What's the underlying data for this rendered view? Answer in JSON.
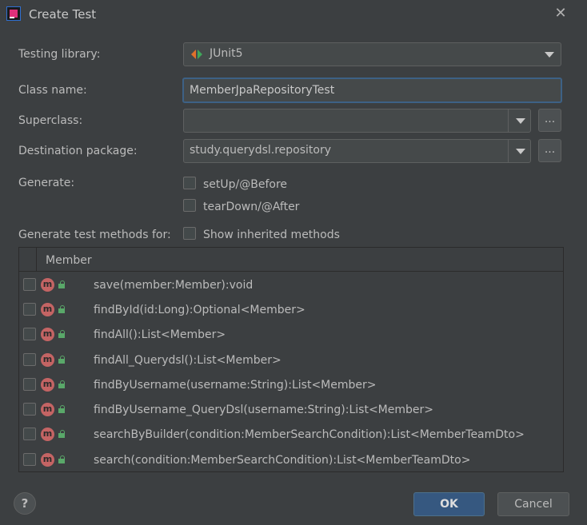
{
  "window": {
    "title": "Create Test",
    "close_icon": "close-icon"
  },
  "form": {
    "testing_library_label": "Testing library:",
    "testing_library_value": "JUnit5",
    "class_name_label": "Class name:",
    "class_name_value": "MemberJpaRepositoryTest",
    "superclass_label": "Superclass:",
    "superclass_value": "",
    "destination_label": "Destination package:",
    "destination_value": "study.querydsl.repository",
    "browse_label": "...",
    "generate_label": "Generate:",
    "setup_label": "setUp/@Before",
    "teardown_label": "tearDown/@After",
    "methods_for_label": "Generate test methods for:",
    "show_inherited_label": "Show inherited methods"
  },
  "table": {
    "header": "Member",
    "rows": [
      {
        "method": "save(member:Member):void"
      },
      {
        "method": "findById(id:Long):Optional<Member>"
      },
      {
        "method": "findAll():List<Member>"
      },
      {
        "method": "findAll_Querydsl():List<Member>"
      },
      {
        "method": "findByUsername(username:String):List<Member>"
      },
      {
        "method": "findByUsername_QueryDsl(username:String):List<Member>"
      },
      {
        "method": "searchByBuilder(condition:MemberSearchCondition):List<MemberTeamDto>"
      },
      {
        "method": "search(condition:MemberSearchCondition):List<MemberTeamDto>"
      }
    ],
    "method_icon_letter": "m"
  },
  "footer": {
    "help_label": "?",
    "ok_label": "OK",
    "cancel_label": "Cancel"
  },
  "colors": {
    "background": "#3c3f41",
    "field": "#45494a",
    "focus_border": "#3d6185",
    "ok_button": "#365880",
    "method_icon": "#c46464",
    "lock_icon": "#59a869"
  }
}
